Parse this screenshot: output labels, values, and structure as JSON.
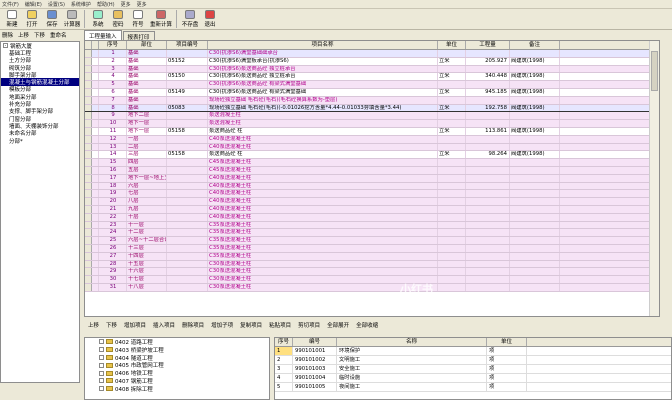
{
  "menu": [
    "文件(F)",
    "编辑(E)",
    "设置(S)",
    "系统维护",
    "帮助(H)",
    "更多",
    "更多"
  ],
  "toolbar": {
    "new": "新建",
    "open": "打开",
    "save": "保存",
    "calc": "计算器",
    "system": "系统",
    "password": "密码",
    "symbol": "符号",
    "recalc": "重新计算",
    "nosave": "不存盘",
    "exit": "退出"
  },
  "nav": {
    "delete": "删除",
    "up": "上移",
    "down": "下移",
    "rename": "重命名"
  },
  "tree": [
    {
      "label": "钢筋大厦",
      "toggle": "-"
    },
    {
      "label": "基础工程",
      "toggle": ""
    },
    {
      "label": "土方分部",
      "toggle": ""
    },
    {
      "label": "砌筑分部",
      "toggle": ""
    },
    {
      "label": "脚手架分部",
      "toggle": ""
    },
    {
      "label": "混凝土与钢筋混凝土分部",
      "toggle": "",
      "selected": true
    },
    {
      "label": "模板分部",
      "toggle": ""
    },
    {
      "label": "地面采分部",
      "toggle": ""
    },
    {
      "label": "补充分部",
      "toggle": ""
    },
    {
      "label": "支撑、脚手架分部",
      "toggle": ""
    },
    {
      "label": "门窗分部",
      "toggle": ""
    },
    {
      "label": "墙面、天棚装饰分部",
      "toggle": ""
    },
    {
      "label": "未命名分部",
      "toggle": ""
    },
    {
      "label": "分部*",
      "toggle": ""
    }
  ],
  "tabs": [
    "工程量输入",
    "报表打印"
  ],
  "grid": {
    "headers": [
      "序号",
      "部位",
      "项目编号",
      "项目名称",
      "单位",
      "工程量",
      "备注"
    ],
    "rows": [
      {
        "seq": "1",
        "part": "基础",
        "code": "",
        "name": "C30(抗渗S6)满堂基础础承台",
        "unit": "",
        "qty": "",
        "note": "",
        "bg": "bg2"
      },
      {
        "seq": "2",
        "part": "基础",
        "code": "05152",
        "name": "C30(抗渗S6)满堂板承台(抗渗S6)",
        "unit": "立米",
        "qty": "205.927",
        "note": "阀建筑(1998)",
        "bg": "bg1"
      },
      {
        "seq": "3",
        "part": "基础",
        "code": "",
        "name": "C30(抗渗S6)泵送商品砼 独立桩承台",
        "unit": "",
        "qty": "",
        "note": "",
        "bg": "bg0"
      },
      {
        "seq": "4",
        "part": "基础",
        "code": "05150",
        "name": "C30(抗渗S6)泵送商品砼 独立桩承台",
        "unit": "立米",
        "qty": "340.448",
        "note": "阀建筑(1998)",
        "bg": "bg1"
      },
      {
        "seq": "5",
        "part": "基础",
        "code": "",
        "name": "C30(抗渗S6)泵送商品砼 有梁式满堂基础",
        "unit": "",
        "qty": "",
        "note": "",
        "bg": "bg0"
      },
      {
        "seq": "6",
        "part": "基础",
        "code": "05149",
        "name": "C30(抗渗S6)泵送商品砼 有梁式满堂基础",
        "unit": "立米",
        "qty": "945.185",
        "note": "阀建筑(1998)",
        "bg": "bg1"
      },
      {
        "seq": "7",
        "part": "基础",
        "code": "",
        "name": "现场砼独立基础 毛石砼(毛石)(毛石砼换算系数为-垫层)",
        "unit": "",
        "qty": "",
        "note": "",
        "bg": "bg0"
      },
      {
        "seq": "8",
        "part": "基础",
        "code": "05083",
        "name": "现场砼独立基础 毛石砼(毛石)(-0.01026挖方含量*4.44-0.01033夯填含量*3.44)",
        "unit": "立米",
        "qty": "192.758",
        "note": "阀建筑(1998)",
        "bg": "bg2",
        "sep": true
      },
      {
        "seq": "9",
        "part": "地下二层",
        "code": "",
        "name": "泵送混凝土柱",
        "unit": "",
        "qty": "",
        "note": "",
        "bg": "bg0"
      },
      {
        "seq": "10",
        "part": "地下一层",
        "code": "",
        "name": "泵送混凝土柱",
        "unit": "",
        "qty": "",
        "note": "",
        "bg": "bg0"
      },
      {
        "seq": "11",
        "part": "地下一层",
        "code": "05158",
        "name": "泵送商品砼 柱",
        "unit": "立米",
        "qty": "113.861",
        "note": "阀建筑(1998)",
        "bg": "bg1"
      },
      {
        "seq": "12",
        "part": "一层",
        "code": "",
        "name": "C40泵送混凝土柱",
        "unit": "",
        "qty": "",
        "note": "",
        "bg": "bg0"
      },
      {
        "seq": "13",
        "part": "二层",
        "code": "",
        "name": "C40泵送混凝土柱",
        "unit": "",
        "qty": "",
        "note": "",
        "bg": "bg0"
      },
      {
        "seq": "14",
        "part": "三层",
        "code": "05158",
        "name": "泵送商品砼 柱",
        "unit": "立米",
        "qty": "98.264",
        "note": "阀建筑(1998)",
        "bg": "bg1"
      },
      {
        "seq": "15",
        "part": "四层",
        "code": "",
        "name": "C45泵送混凝土柱",
        "unit": "",
        "qty": "",
        "note": "",
        "bg": "bg0"
      },
      {
        "seq": "16",
        "part": "五层",
        "code": "",
        "name": "C45泵送混凝土柱",
        "unit": "",
        "qty": "",
        "note": "",
        "bg": "bg0"
      },
      {
        "seq": "17",
        "part": "地下一层~地上五层合计",
        "code": "",
        "name": "C40泵送混凝土柱",
        "unit": "",
        "qty": "",
        "note": "",
        "bg": "bg0"
      },
      {
        "seq": "18",
        "part": "六层",
        "code": "",
        "name": "C40泵送混凝土柱",
        "unit": "",
        "qty": "",
        "note": "",
        "bg": "bg0"
      },
      {
        "seq": "19",
        "part": "七层",
        "code": "",
        "name": "C40泵送混凝土柱",
        "unit": "",
        "qty": "",
        "note": "",
        "bg": "bg0"
      },
      {
        "seq": "20",
        "part": "八层",
        "code": "",
        "name": "C40泵送混凝土柱",
        "unit": "",
        "qty": "",
        "note": "",
        "bg": "bg0"
      },
      {
        "seq": "21",
        "part": "九层",
        "code": "",
        "name": "C40泵送混凝土柱",
        "unit": "",
        "qty": "",
        "note": "",
        "bg": "bg0"
      },
      {
        "seq": "22",
        "part": "十层",
        "code": "",
        "name": "C40泵送混凝土柱",
        "unit": "",
        "qty": "",
        "note": "",
        "bg": "bg0"
      },
      {
        "seq": "23",
        "part": "十一层",
        "code": "",
        "name": "C35泵送混凝土柱",
        "unit": "",
        "qty": "",
        "note": "",
        "bg": "bg0"
      },
      {
        "seq": "24",
        "part": "十二层",
        "code": "",
        "name": "C35泵送混凝土柱",
        "unit": "",
        "qty": "",
        "note": "",
        "bg": "bg0"
      },
      {
        "seq": "25",
        "part": "六层~十二层合计",
        "code": "",
        "name": "C35泵送混凝土柱",
        "unit": "",
        "qty": "",
        "note": "",
        "bg": "bg0"
      },
      {
        "seq": "26",
        "part": "十三层",
        "code": "",
        "name": "C35泵送混凝土柱",
        "unit": "",
        "qty": "",
        "note": "",
        "bg": "bg0"
      },
      {
        "seq": "27",
        "part": "十四层",
        "code": "",
        "name": "C35泵送混凝土柱",
        "unit": "",
        "qty": "",
        "note": "",
        "bg": "bg0"
      },
      {
        "seq": "28",
        "part": "十五层",
        "code": "",
        "name": "C30泵送混凝土柱",
        "unit": "",
        "qty": "",
        "note": "",
        "bg": "bg0"
      },
      {
        "seq": "29",
        "part": "十六层",
        "code": "",
        "name": "C30泵送混凝土柱",
        "unit": "",
        "qty": "",
        "note": "",
        "bg": "bg0"
      },
      {
        "seq": "30",
        "part": "十七层",
        "code": "",
        "name": "C30泵送混凝土柱",
        "unit": "",
        "qty": "",
        "note": "",
        "bg": "bg0"
      },
      {
        "seq": "31",
        "part": "十八层",
        "code": "",
        "name": "C30泵送混凝土柱",
        "unit": "",
        "qty": "",
        "note": "",
        "bg": "bg0"
      }
    ]
  },
  "bottom_tools": [
    "上移",
    "下移",
    "增加项目",
    "插入项目",
    "删除项目",
    "增加子项",
    "复制项目",
    "粘贴项目",
    "剪切项目",
    "全部展开",
    "全部收缩"
  ],
  "chapters": [
    "0402 道路工程",
    "0403 桥梁护坡工程",
    "0404 隧道工程",
    "0405 市政管网工程",
    "0406 地铁工程",
    "0407 钢筋工程",
    "0408 拆除工程"
  ],
  "items": {
    "headers": [
      "序号",
      "编号",
      "名称",
      "单位"
    ],
    "rows": [
      {
        "no": "1",
        "code": "990101001",
        "name": "环境保护",
        "unit": "项",
        "selected": true
      },
      {
        "no": "2",
        "code": "990101002",
        "name": "文明施工",
        "unit": "项"
      },
      {
        "no": "3",
        "code": "990101003",
        "name": "安全施工",
        "unit": "项"
      },
      {
        "no": "4",
        "code": "990101004",
        "name": "临时设施",
        "unit": "项"
      },
      {
        "no": "5",
        "code": "990101005",
        "name": "夜间施工",
        "unit": "项"
      }
    ]
  },
  "watermark": "小红书"
}
